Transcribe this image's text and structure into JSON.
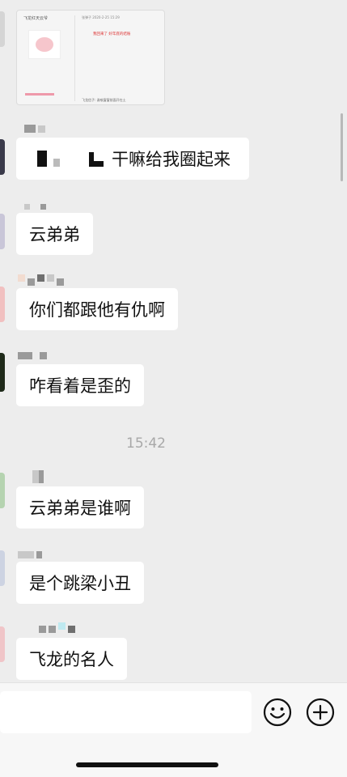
{
  "messages": [
    {
      "text": "干嘛给我圈起来"
    },
    {
      "text": "云弟弟"
    },
    {
      "text": "你们都跟他有仇啊"
    },
    {
      "text": "咋看着是歪的"
    },
    {
      "text": "云弟弟是谁啊"
    },
    {
      "text": "是个跳梁小丑"
    },
    {
      "text": "飞龙的名人"
    }
  ],
  "timestamp": "15:42",
  "shared_image": {
    "left_title": "飞龙红天云爷",
    "right_meta": "张弹子 2020-2-25 15:29",
    "red_text": "我回来了 好年底的结账",
    "footer": "飞龙信子: 诶唉窗窗前面开在土"
  },
  "input": {
    "value": "",
    "placeholder": ""
  },
  "icons": {
    "emoji": "emoji-icon",
    "plus": "plus-icon"
  },
  "colors": {
    "background": "#ededed",
    "bubble": "#ffffff",
    "time": "#a8a8a8"
  }
}
